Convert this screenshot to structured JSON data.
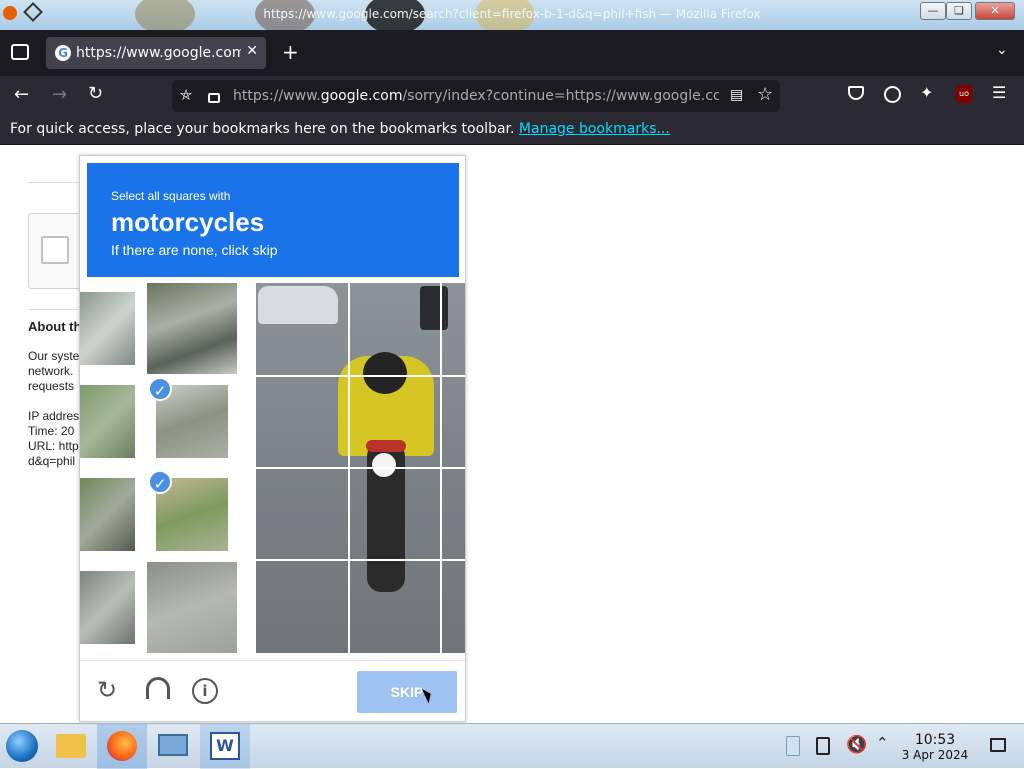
{
  "window": {
    "title": "https://www.google.com/search?client=firefox-b-1-d&q=phil+fish — Mozilla Firefox",
    "minimize_icon": "minimize-icon",
    "maximize_icon": "maximize-icon",
    "close_icon": "close-icon"
  },
  "tabs": [
    {
      "label": "https://www.google.com/",
      "favicon": "G",
      "active": true
    }
  ],
  "navbar": {
    "url_prefix": "https://www.",
    "url_domain": "google.com",
    "url_rest": "/sorry/index?continue=https://www.google.cc"
  },
  "bookmarks": {
    "message": "For quick access, place your bookmarks here on the bookmarks toolbar.",
    "link": "Manage bookmarks..."
  },
  "page": {
    "about_heading": "About th",
    "body_lines": [
      "Our syste",
      "network.",
      "requests"
    ],
    "ip_line": "IP addres",
    "time_line": "Time: 20",
    "url_line": "URL: http",
    "url_line2": "d&q=phil"
  },
  "captcha": {
    "instruction": "Select all squares with",
    "target": "motorcycles",
    "hint": "If there are none, click skip",
    "skip_label": "SKIP",
    "selected_tiles": 2
  },
  "taskbar": {
    "time": "10:53",
    "date": "3 Apr 2024"
  },
  "colors": {
    "captcha_blue": "#1a73e8",
    "skip_disabled": "#9ec3f2",
    "check_blue": "#4a90e2",
    "link_cyan": "#00ddff"
  }
}
